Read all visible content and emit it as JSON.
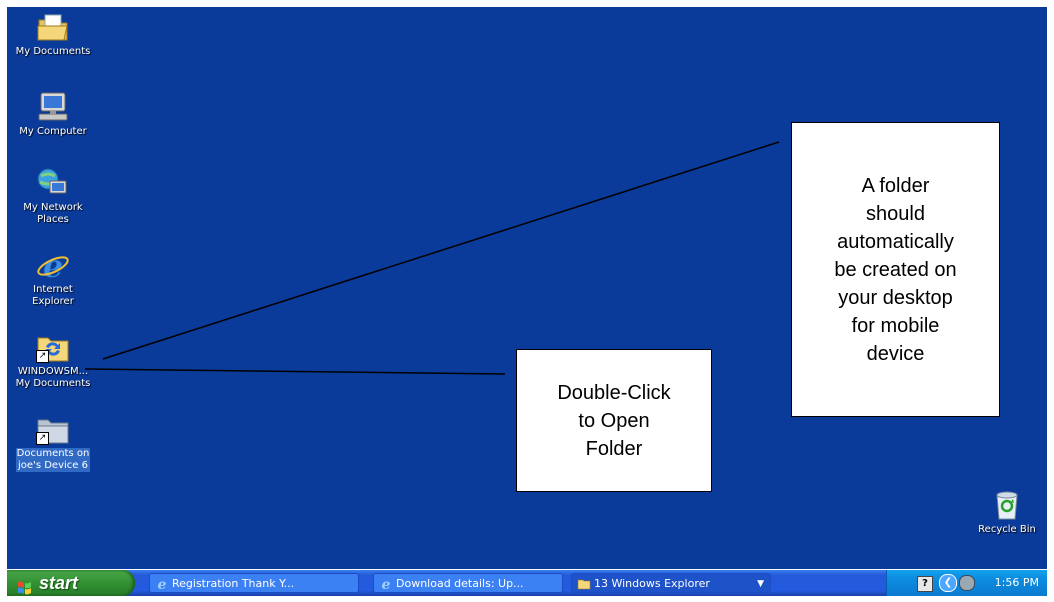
{
  "desktop": {
    "icons": [
      {
        "label": "My Documents"
      },
      {
        "label": "My Computer"
      },
      {
        "label": "My Network\nPlaces"
      },
      {
        "label": "Internet\nExplorer"
      },
      {
        "label": "WINDOWSM...\nMy Documents"
      },
      {
        "label": "Documents on\njoe's Device 6"
      }
    ],
    "recycle_bin": {
      "label": "Recycle Bin"
    }
  },
  "callouts": {
    "folder_note": "A folder\nshould\nautomatically\nbe created on\nyour desktop\nfor mobile\ndevice",
    "double_click_note": "Double-Click\nto Open\nFolder"
  },
  "taskbar": {
    "start_label": "start",
    "tasks": [
      {
        "label": "Registration Thank Y...",
        "icon": "ie-icon"
      },
      {
        "label": "Download details: Up...",
        "icon": "ie-icon"
      },
      {
        "label": "13 Windows Explorer",
        "icon": "folder-icon"
      }
    ],
    "tray": {
      "time": "1:56 PM"
    }
  },
  "colors": {
    "desktop": "#0a3a9a",
    "start_green": "#2f8d2f",
    "taskbar_blue": "#245ae0",
    "tray_blue": "#0d8de0"
  }
}
